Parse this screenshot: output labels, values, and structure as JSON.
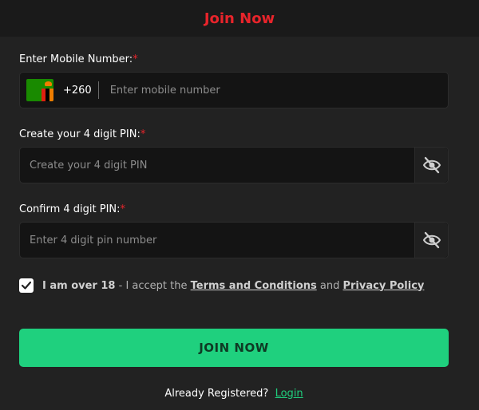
{
  "header": {
    "title": "Join Now"
  },
  "mobile": {
    "label": "Enter Mobile Number:",
    "required_mark": "*",
    "country_code": "+260",
    "flag_icon": "zambia-flag-icon",
    "placeholder": "Enter mobile number"
  },
  "pin": {
    "label": "Create your 4 digit PIN:",
    "required_mark": "*",
    "placeholder": "Create your 4 digit PIN",
    "toggle_icon": "eye-slash-icon"
  },
  "confirm_pin": {
    "label": "Confirm 4 digit PIN:",
    "required_mark": "*",
    "placeholder": "Enter 4 digit pin number",
    "toggle_icon": "eye-slash-icon"
  },
  "consent": {
    "checked": true,
    "age_text": "I am over 18",
    "dash": " - ",
    "accept_text": "I accept the ",
    "terms_link": "Terms and Conditions",
    "and_text": " and ",
    "privacy_link": "Privacy Policy"
  },
  "submit": {
    "label": "JOIN NOW"
  },
  "footer": {
    "already_text": "Already Registered?  ",
    "login_link": "Login"
  },
  "colors": {
    "accent_red": "#e8242b",
    "accent_green": "#1fd07e",
    "background": "#222222",
    "field_bg": "#141414"
  }
}
